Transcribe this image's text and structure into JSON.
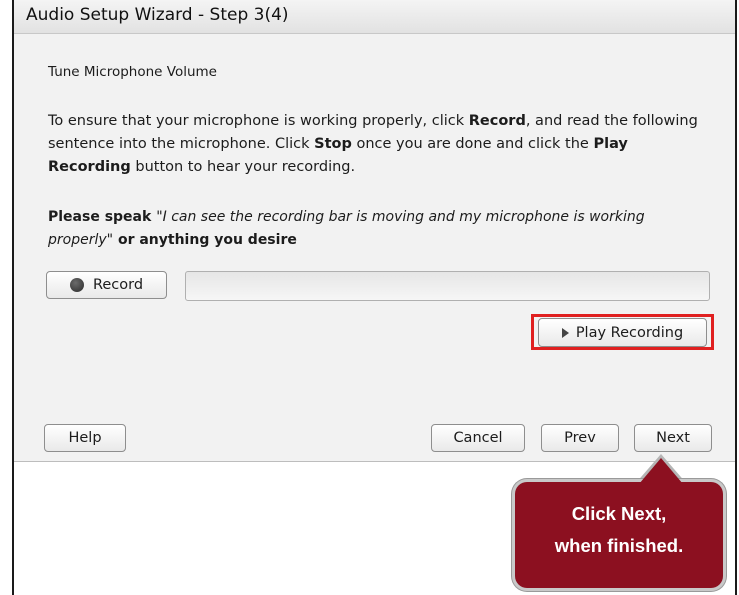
{
  "window": {
    "title": "Audio Setup Wizard - Step 3(4)"
  },
  "content": {
    "heading": "Tune Microphone Volume",
    "instructions": {
      "part1": "To ensure that your microphone is working properly, click ",
      "record_word": "Record",
      "part2": ", and read the following sentence into the microphone. Click ",
      "stop_word": "Stop",
      "part3": " once you are done and click the ",
      "play_word": "Play Recording",
      "part4": " button to hear your recording."
    },
    "speak": {
      "prefix": "Please speak ",
      "quote": "\"I can see the recording bar is moving and my microphone is working properly\"",
      "suffix": " or anything you desire"
    }
  },
  "controls": {
    "record_label": "Record",
    "play_label": "Play Recording",
    "recording_level": 0
  },
  "footer": {
    "help_label": "Help",
    "cancel_label": "Cancel",
    "prev_label": "Prev",
    "next_label": "Next"
  },
  "callout": {
    "line1": "Click Next,",
    "line2": "when finished.",
    "color": "#8c1020"
  },
  "colors": {
    "highlight": "#e02020",
    "panel": "#f2f2f2"
  },
  "icons": {
    "record": "record-dot-icon",
    "play": "play-triangle-icon"
  }
}
